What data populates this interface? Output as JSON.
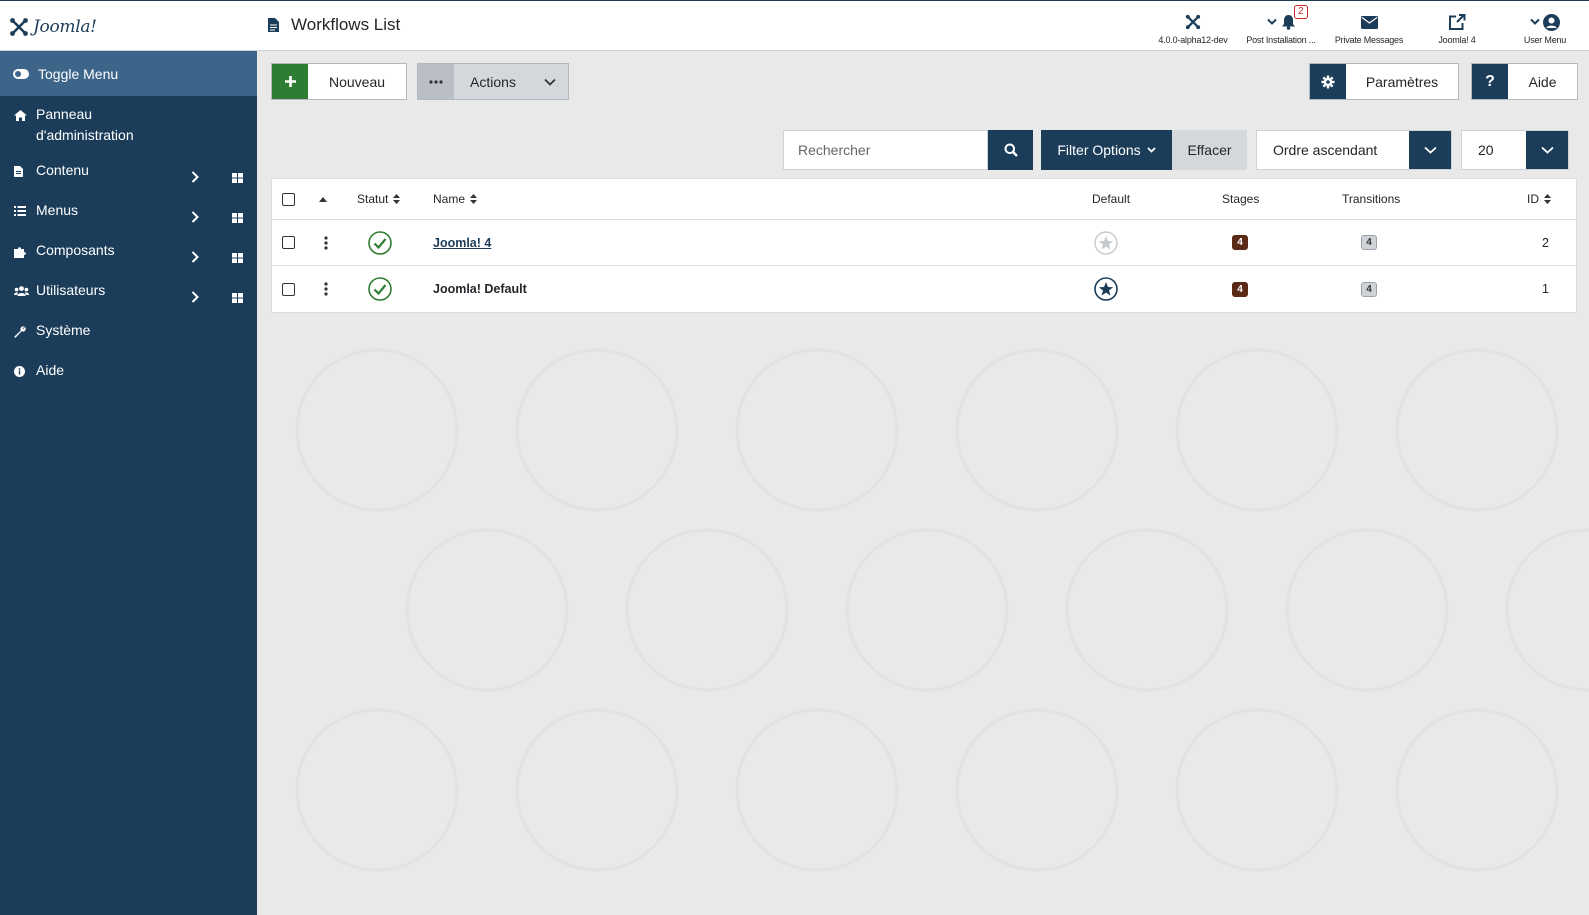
{
  "header": {
    "logo_text": "Joomla!",
    "page_title": "Workflows List",
    "items": [
      {
        "label": "4.0.0-alpha12-dev",
        "icon": "joomla-icon"
      },
      {
        "label": "Post Installation ...",
        "icon": "bell-icon",
        "badge": "2"
      },
      {
        "label": "Private Messages",
        "icon": "envelope-icon"
      },
      {
        "label": "Joomla! 4",
        "icon": "external-link-icon"
      },
      {
        "label": "User Menu",
        "icon": "user-circle-icon"
      }
    ]
  },
  "sidebar": {
    "toggle_label": "Toggle Menu",
    "items": [
      {
        "label": "Panneau d'administration",
        "line1": "Panneau",
        "line2": "d'administration",
        "icon": "home-icon"
      },
      {
        "label": "Contenu",
        "icon": "file-icon",
        "has_children": true
      },
      {
        "label": "Menus",
        "icon": "list-icon",
        "has_children": true
      },
      {
        "label": "Composants",
        "icon": "puzzle-icon",
        "has_children": true
      },
      {
        "label": "Utilisateurs",
        "icon": "users-icon",
        "has_children": true
      },
      {
        "label": "Système",
        "icon": "wrench-icon"
      },
      {
        "label": "Aide",
        "icon": "info-icon"
      }
    ]
  },
  "toolbar": {
    "new_label": "Nouveau",
    "actions_label": "Actions",
    "options_label": "Paramètres",
    "help_label": "Aide"
  },
  "filters": {
    "search_placeholder": "Rechercher",
    "filter_options_label": "Filter Options",
    "clear_label": "Effacer",
    "ordering_value": "Ordre ascendant",
    "limit_value": "20"
  },
  "table": {
    "headers": {
      "status": "Statut",
      "name": "Name",
      "default": "Default",
      "stages": "Stages",
      "transitions": "Transitions",
      "id": "ID"
    },
    "rows": [
      {
        "name": "Joomla! 4",
        "is_link": true,
        "default": false,
        "stages": "4",
        "transitions": "4",
        "id": "2"
      },
      {
        "name": "Joomla! Default",
        "is_link": false,
        "default": true,
        "stages": "4",
        "transitions": "4",
        "id": "1"
      }
    ]
  },
  "colors": {
    "primary": "#1c3d5a",
    "sidebar_active": "#3c6589",
    "success": "#2f7d32",
    "badge_dark": "#5a2a16",
    "danger": "#c52827"
  }
}
